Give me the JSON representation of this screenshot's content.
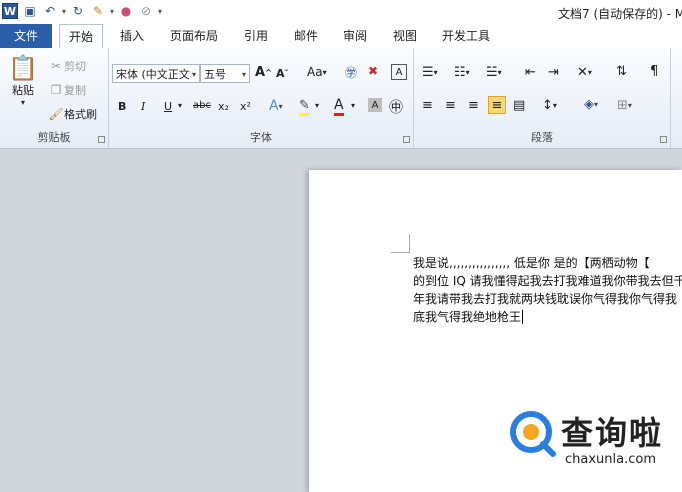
{
  "window": {
    "title": "文档7 (自动保存的) - M"
  },
  "tabs": [
    {
      "label": "文件"
    },
    {
      "label": "开始"
    },
    {
      "label": "插入"
    },
    {
      "label": "页面布局"
    },
    {
      "label": "引用"
    },
    {
      "label": "邮件"
    },
    {
      "label": "审阅"
    },
    {
      "label": "视图"
    },
    {
      "label": "开发工具"
    }
  ],
  "clipboard": {
    "group_label": "剪贴板",
    "paste": "粘贴",
    "cut": "剪切",
    "copy": "复制",
    "format_painter": "格式刷"
  },
  "font": {
    "group_label": "字体",
    "font_name": "宋体 (中文正文",
    "font_size": "五号",
    "grow": "A",
    "shrink": "A",
    "case": "Aa",
    "bold": "B",
    "italic": "I",
    "underline": "U",
    "strike": "abc",
    "subscript": "x₂",
    "superscript": "x²"
  },
  "paragraph": {
    "group_label": "段落"
  },
  "document": {
    "lines": [
      "我是说,,,,,,,,,,,,,,,, 低是你 是的【两栖动物【",
      "的到位 IQ 请我懂得起我去打我难道我你带我去但千",
      "年我请带我去打我就两块钱耽误你气得我你气得我",
      "底我气得我绝地枪王"
    ]
  },
  "watermark": {
    "cn": "查询啦",
    "en": "chaxunla.com"
  },
  "colors": {
    "accent": "#2a5ea8",
    "doc_bg": "#d1d6dc"
  }
}
